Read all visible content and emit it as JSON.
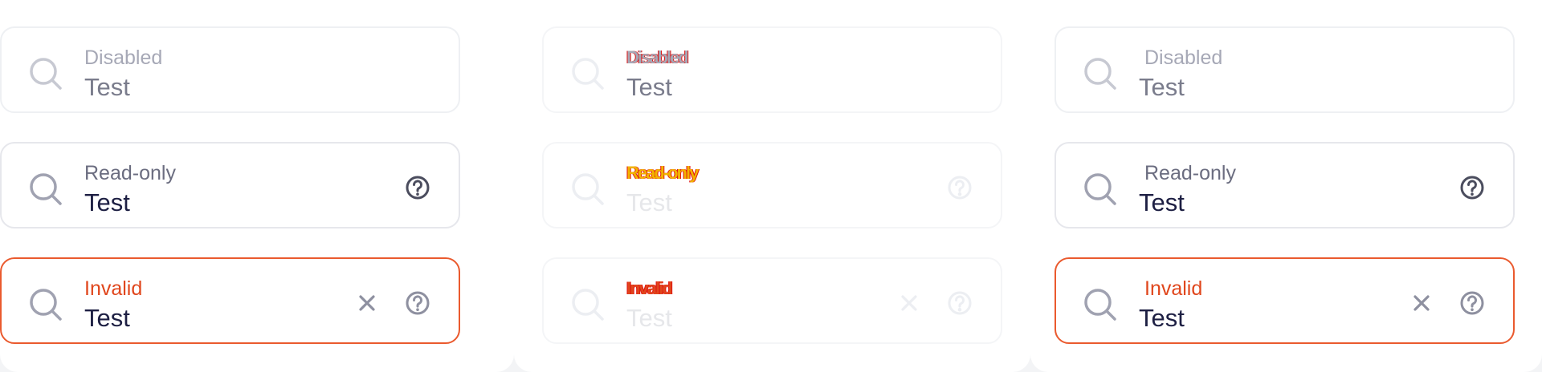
{
  "fields": {
    "disabled": {
      "label": "Disabled",
      "value": "Test"
    },
    "readonly": {
      "label": "Read-only",
      "value": "Test"
    },
    "invalid": {
      "label": "Invalid",
      "value": "Test"
    }
  },
  "icons": {
    "search": "search-icon",
    "help": "help-circle-icon",
    "clear": "close-icon"
  },
  "colors": {
    "border": "#e6e7ec",
    "error": "#e0461c",
    "text": "#1d1f43",
    "label": "#6b6d80"
  }
}
